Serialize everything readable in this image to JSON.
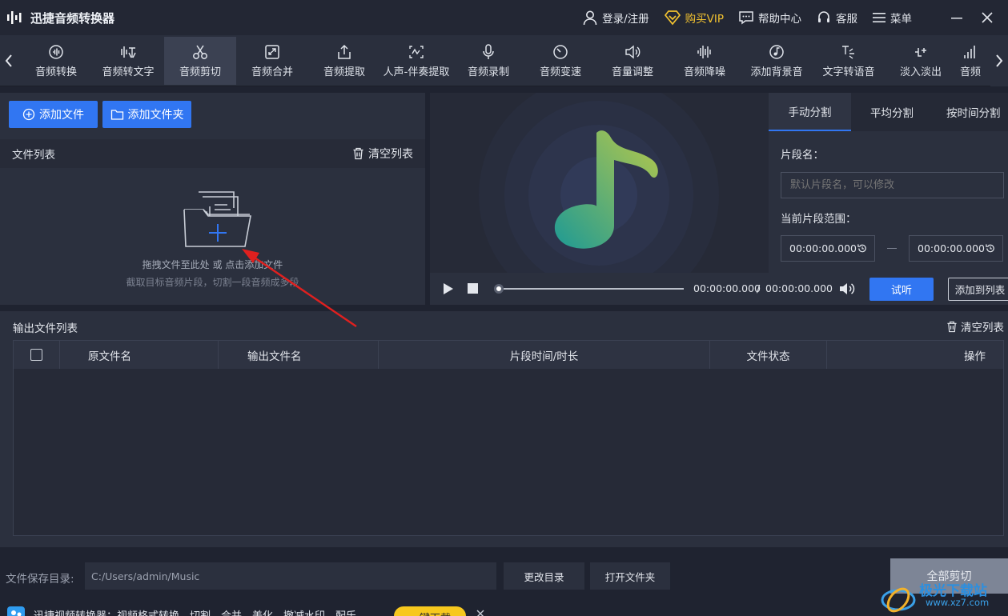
{
  "app": {
    "title": "迅捷音频转换器"
  },
  "titlebar": {
    "login": "登录/注册",
    "vip": "购买VIP",
    "help": "帮助中心",
    "service": "客服",
    "menu": "菜单"
  },
  "toolbar": {
    "tools": [
      {
        "label": "音频转换",
        "icon": "audio-convert-icon"
      },
      {
        "label": "音频转文字",
        "icon": "audio-to-text-icon"
      },
      {
        "label": "音频剪切",
        "icon": "scissors-icon",
        "active": true
      },
      {
        "label": "音频合并",
        "icon": "merge-icon"
      },
      {
        "label": "音频提取",
        "icon": "extract-icon"
      },
      {
        "label": "人声-伴奏提取",
        "icon": "vocal-icon"
      },
      {
        "label": "音频录制",
        "icon": "microphone-icon"
      },
      {
        "label": "音频变速",
        "icon": "speed-icon"
      },
      {
        "label": "音量调整",
        "icon": "volume-icon"
      },
      {
        "label": "音频降噪",
        "icon": "denoise-icon"
      },
      {
        "label": "添加背景音",
        "icon": "background-music-icon"
      },
      {
        "label": "文字转语音",
        "icon": "text-to-speech-icon"
      },
      {
        "label": "淡入淡出",
        "icon": "fade-icon"
      },
      {
        "label": "音频",
        "icon": "audio-bars-icon"
      }
    ]
  },
  "files": {
    "add_file": "添加文件",
    "add_folder": "添加文件夹",
    "list_title": "文件列表",
    "clear": "清空列表",
    "hint1": "拖拽文件至此处 或 点击添加文件",
    "hint2": "截取目标音频片段，切割一段音频成多段"
  },
  "player": {
    "current": "00:00:00.000",
    "separator": "/",
    "total": "00:00:00.000",
    "listen": "试听",
    "add_to_list": "添加到列表",
    "progress": 0
  },
  "split": {
    "tabs": [
      "手动分割",
      "平均分割",
      "按时间分割"
    ],
    "segment_name_label": "片段名：",
    "segment_name_placeholder": "默认片段名，可以修改",
    "range_label": "当前片段范围：",
    "start": "00:00:00.000",
    "end": "00:00:00.000"
  },
  "output": {
    "title": "输出文件列表",
    "clear": "清空列表",
    "columns": [
      "原文件名",
      "输出文件名",
      "片段时间/时长",
      "文件状态",
      "操作"
    ]
  },
  "bottom": {
    "dir_label": "文件保存目录:",
    "dir_value": "C:/Users/admin/Music",
    "change_dir": "更改目录",
    "open_folder": "打开文件夹",
    "cut_all": "全部剪切"
  },
  "ad": {
    "text": "迅捷视频转换器：视频格式转换、切割、合并、美化、撤减水印、配乐",
    "button": "一键下载"
  },
  "watermark": {
    "text": "极光下载站",
    "site": "www.xz7.com"
  },
  "colors": {
    "accent": "#3176f2",
    "vip": "#f2c230",
    "annotation_arrow": "#e0201f"
  }
}
